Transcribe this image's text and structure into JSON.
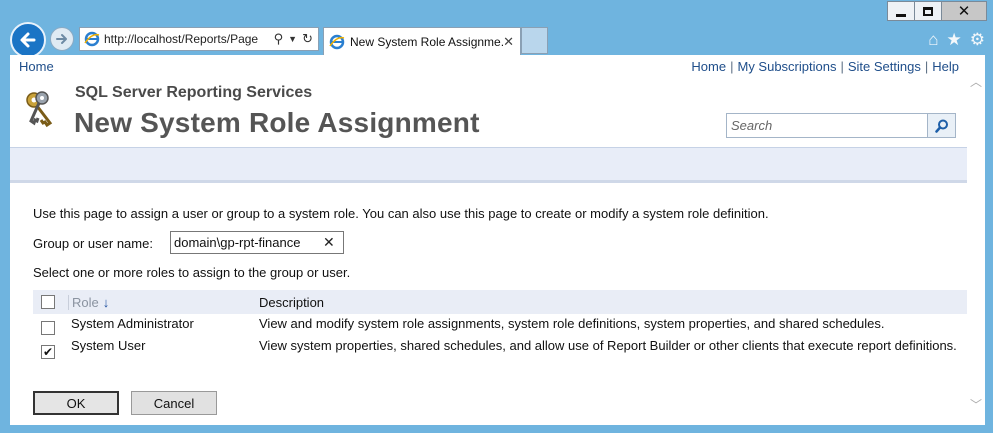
{
  "browser": {
    "address": "http://localhost/Reports/Page",
    "tab_title": "New System Role Assignme...",
    "icons": [
      "home-icon",
      "favorites-star-icon",
      "tools-gear-icon"
    ]
  },
  "nav": {
    "home_left": "Home",
    "links": [
      "Home",
      "My Subscriptions",
      "Site Settings",
      "Help"
    ]
  },
  "header": {
    "subtitle": "SQL Server Reporting Services",
    "title": "New System Role Assignment",
    "search_placeholder": "Search"
  },
  "form": {
    "intro": "Use this page to assign a user or group to a system role. You can also use this page to create or modify a system role definition.",
    "group_label": "Group or user name:",
    "group_value": "domain\\gp-rpt-finance",
    "select_note": "Select one or more roles to assign to the group or user."
  },
  "table": {
    "headers": {
      "role": "Role",
      "description": "Description"
    },
    "rows": [
      {
        "role": "System Administrator",
        "description": "View and modify system role assignments, system role definitions, system properties, and shared schedules.",
        "checked": false
      },
      {
        "role": "System User",
        "description": "View system properties, shared schedules, and allow use of Report Builder or other clients that execute report definitions.",
        "checked": true
      }
    ]
  },
  "buttons": {
    "ok": "OK",
    "cancel": "Cancel"
  }
}
